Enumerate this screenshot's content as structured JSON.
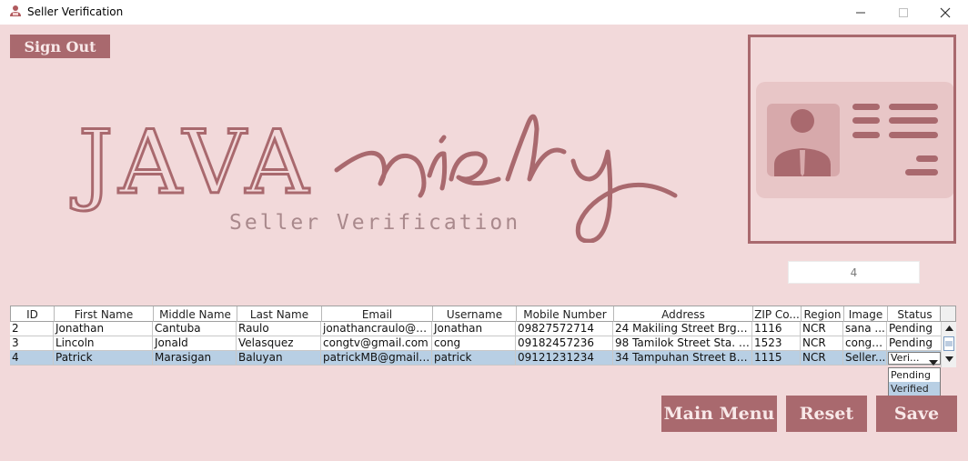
{
  "window": {
    "title": "Seller Verification",
    "icon": "user-icon"
  },
  "header": {
    "sign_out_label": "Sign Out"
  },
  "logo": {
    "brand_caps": "JAVA",
    "brand_script": "riety",
    "subtitle": "Seller Verification"
  },
  "id_card": {
    "icon": "id-card-icon"
  },
  "id_field": {
    "value": "4"
  },
  "table": {
    "columns": [
      "ID",
      "First Name",
      "Middle Name",
      "Last Name",
      "Email",
      "Username",
      "Mobile Number",
      "Address",
      "ZIP Co...",
      "Region",
      "Image",
      "Status"
    ],
    "rows": [
      {
        "cells": [
          "2",
          "Jonathan",
          "Cantuba",
          "Raulo",
          "jonathancraulo@g...",
          "Jonathan",
          "09827572714",
          "24 Makiling Street Brgy. T...",
          "1116",
          "NCR",
          "sana ...",
          "Pending"
        ],
        "selected": false
      },
      {
        "cells": [
          "3",
          "Lincoln",
          "Jonald",
          "Velasquez",
          "congtv@gmail.com",
          "cong",
          "09182457236",
          "98 Tamilok Street Sta. Cl...",
          "1523",
          "NCR",
          "congtv...",
          "Pending"
        ],
        "selected": false
      },
      {
        "cells": [
          "4",
          "Patrick",
          "Marasigan",
          "Baluyan",
          "patrickMB@gmail.c...",
          "patrick",
          "09121231234",
          "34 Tampuhan Street Brgy...",
          "1115",
          "NCR",
          "Seller...",
          "Veri..."
        ],
        "selected": true
      }
    ],
    "status_options": [
      "Pending",
      "Verified"
    ],
    "status_highlighted": "Verified"
  },
  "actions": {
    "main_menu_label": "Main Menu",
    "reset_label": "Reset",
    "save_label": "Save"
  },
  "colors": {
    "background": "#f2d9da",
    "accent": "#a9696e",
    "selection": "#b8cfe4"
  }
}
